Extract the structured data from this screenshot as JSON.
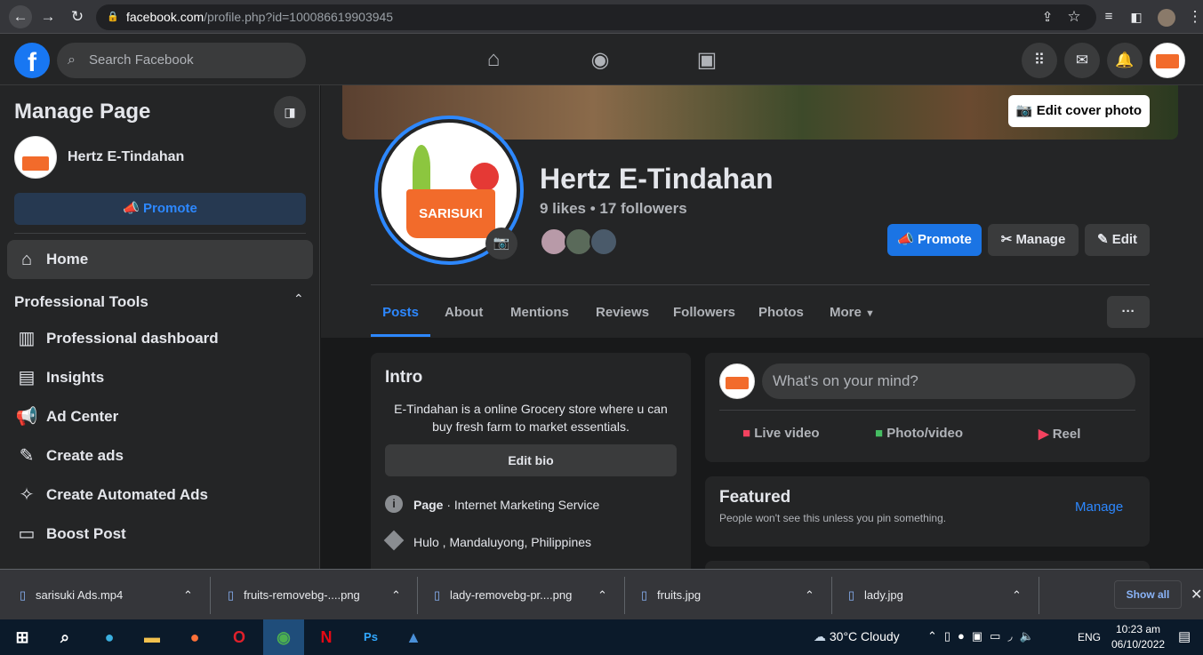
{
  "browser": {
    "url_domain": "facebook.com",
    "url_path": "/profile.php?id=100086619903945"
  },
  "header": {
    "search_placeholder": "Search Facebook"
  },
  "sidebar": {
    "title": "Manage Page",
    "page_name": "Hertz E-Tindahan",
    "promote": "Promote",
    "home": "Home",
    "section": "Professional Tools",
    "items": [
      {
        "label": "Professional dashboard",
        "icon": "dashboard-icon"
      },
      {
        "label": "Insights",
        "icon": "insights-icon"
      },
      {
        "label": "Ad Center",
        "icon": "megaphone-icon"
      },
      {
        "label": "Create ads",
        "icon": "edit-icon"
      },
      {
        "label": "Create Automated Ads",
        "icon": "magic-wand-icon"
      },
      {
        "label": "Boost Post",
        "icon": "boost-icon"
      }
    ]
  },
  "profile": {
    "name": "Hertz E-Tindahan",
    "stats": "9 likes • 17 followers",
    "logo_text": "SARISUKI",
    "edit_cover": "Edit cover photo",
    "promote": "Promote",
    "manage": "Manage",
    "edit": "Edit"
  },
  "tabs": [
    "Posts",
    "About",
    "Mentions",
    "Reviews",
    "Followers",
    "Photos",
    "More"
  ],
  "intro": {
    "title": "Intro",
    "bio": "E-Tindahan is a online Grocery store where u can buy fresh farm to market essentials.",
    "edit_bio": "Edit bio",
    "category_bold": "Page",
    "category": " · Internet Marketing Service",
    "location": "Hulo , Mandaluyong, Philippines"
  },
  "composer": {
    "placeholder": "What's on your mind?",
    "live": "Live video",
    "photo": "Photo/video",
    "reel": "Reel"
  },
  "featured": {
    "title": "Featured",
    "subtitle": "People won't see this unless you pin something.",
    "manage": "Manage"
  },
  "downloads": {
    "items": [
      "sarisuki Ads.mp4",
      "fruits-removebg-....png",
      "lady-removebg-pr....png",
      "fruits.jpg",
      "lady.jpg"
    ],
    "show_all": "Show all"
  },
  "taskbar": {
    "weather": "30°C  Cloudy",
    "lang": "ENG",
    "time": "10:23 am",
    "date": "06/10/2022"
  }
}
